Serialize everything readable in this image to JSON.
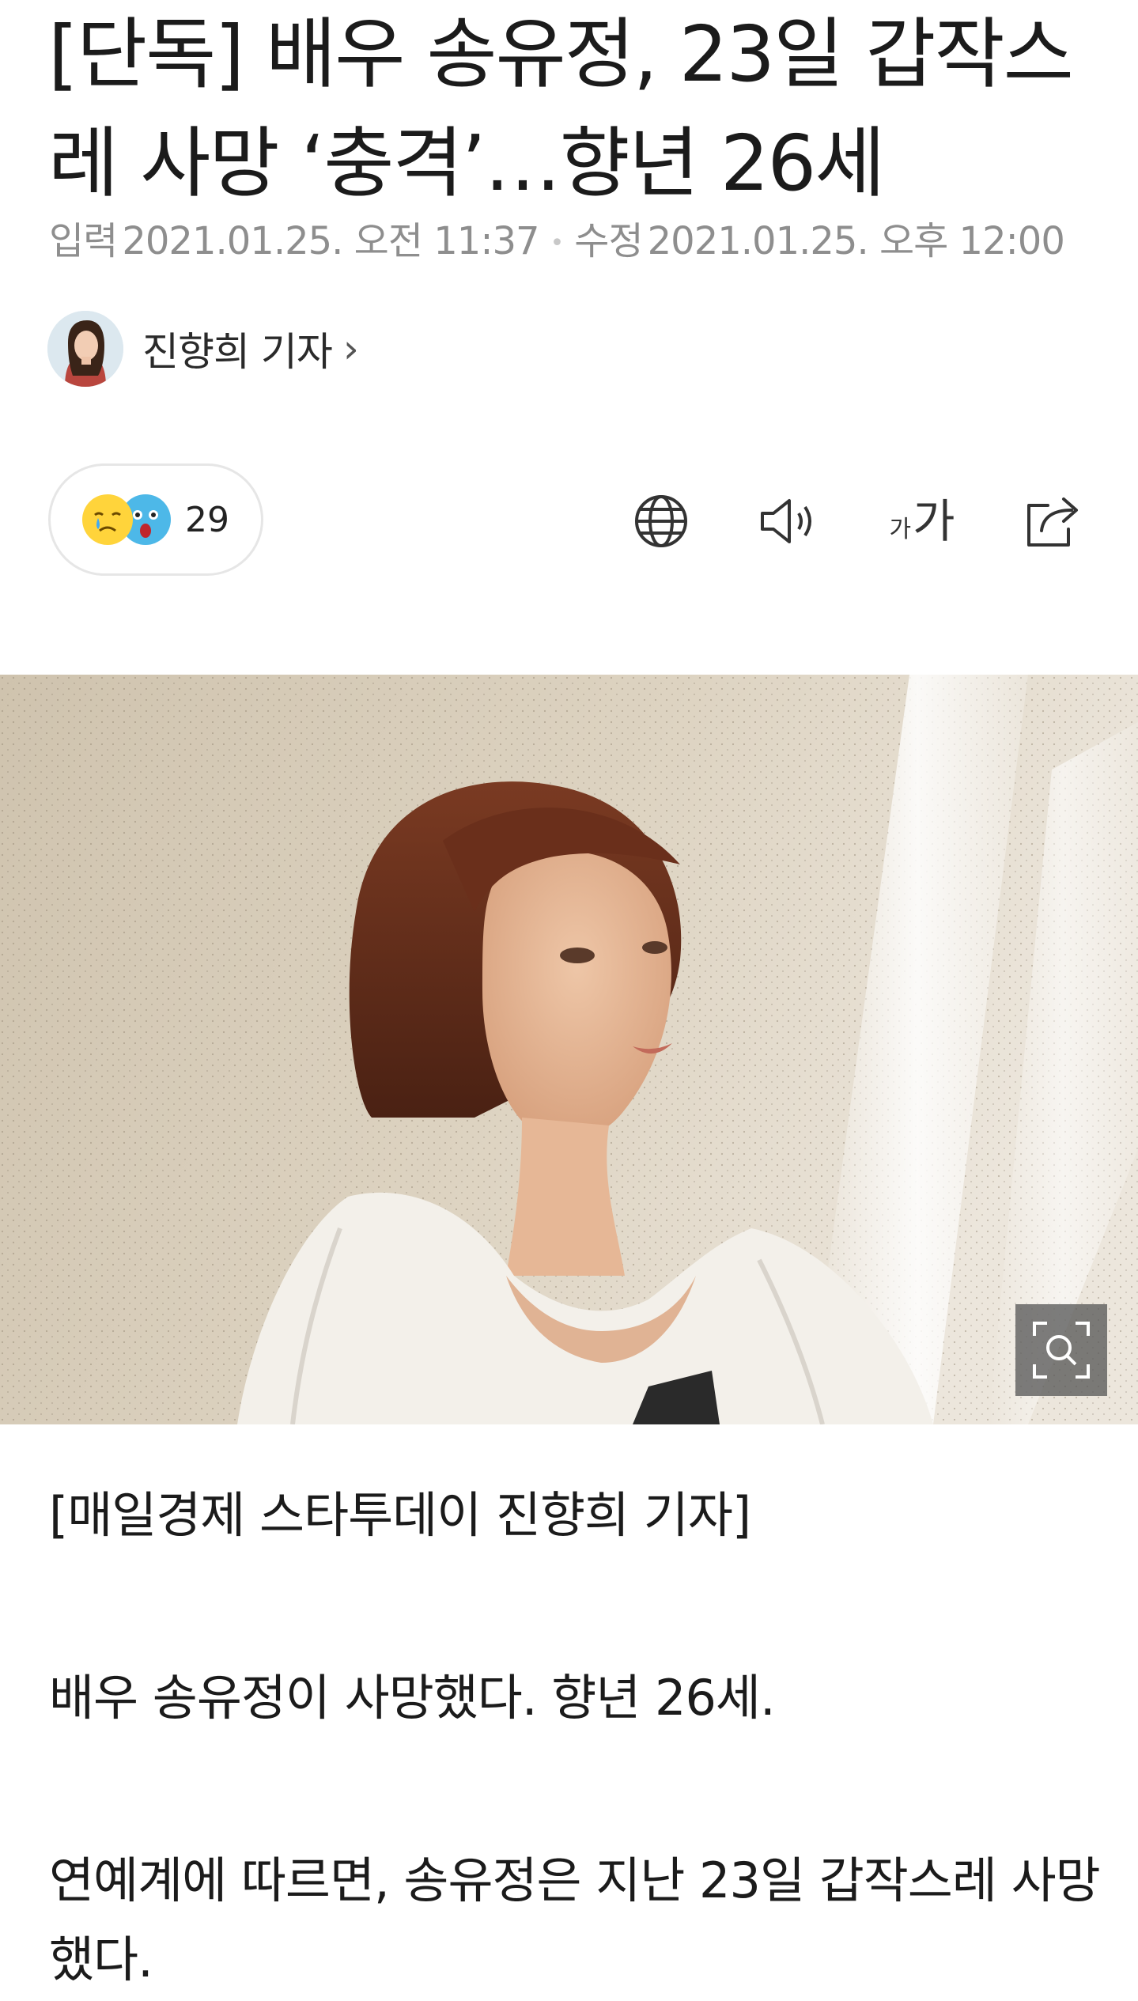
{
  "article": {
    "headline": "[단독] 배우 송유정, 23일 갑작스레 사망 ‘충격’…향년 26세",
    "meta": {
      "input_label": "입력",
      "input_time": "2021.01.25. 오전 11:37",
      "edit_label": "수정",
      "edit_time": "2021.01.25. 오후 12:00"
    },
    "author": {
      "name": "진향희 기자",
      "chevron": "›"
    }
  },
  "toolbar": {
    "reaction_count": "29",
    "reaction_icons": [
      "sad-crying-face-icon",
      "shocked-face-icon"
    ],
    "tools": [
      "globe-icon",
      "speaker-icon",
      "font-size-icon",
      "share-icon"
    ],
    "font_size_small": "가",
    "font_size_large": "가"
  },
  "body": {
    "byline": "[매일경제 스타투데이 진향희 기자]",
    "paragraph_1": "배우 송유정이 사망했다. 향년 26세.",
    "paragraph_2": "연예계에 따르면, 송유정은 지난 23일 갑작스레 사망했다."
  },
  "colors": {
    "text": "#1b1b1b",
    "meta": "#8e8e8e",
    "border": "#e6e6e6",
    "emoji_yellow": "#ffd43b",
    "emoji_blue": "#4db8e8"
  }
}
